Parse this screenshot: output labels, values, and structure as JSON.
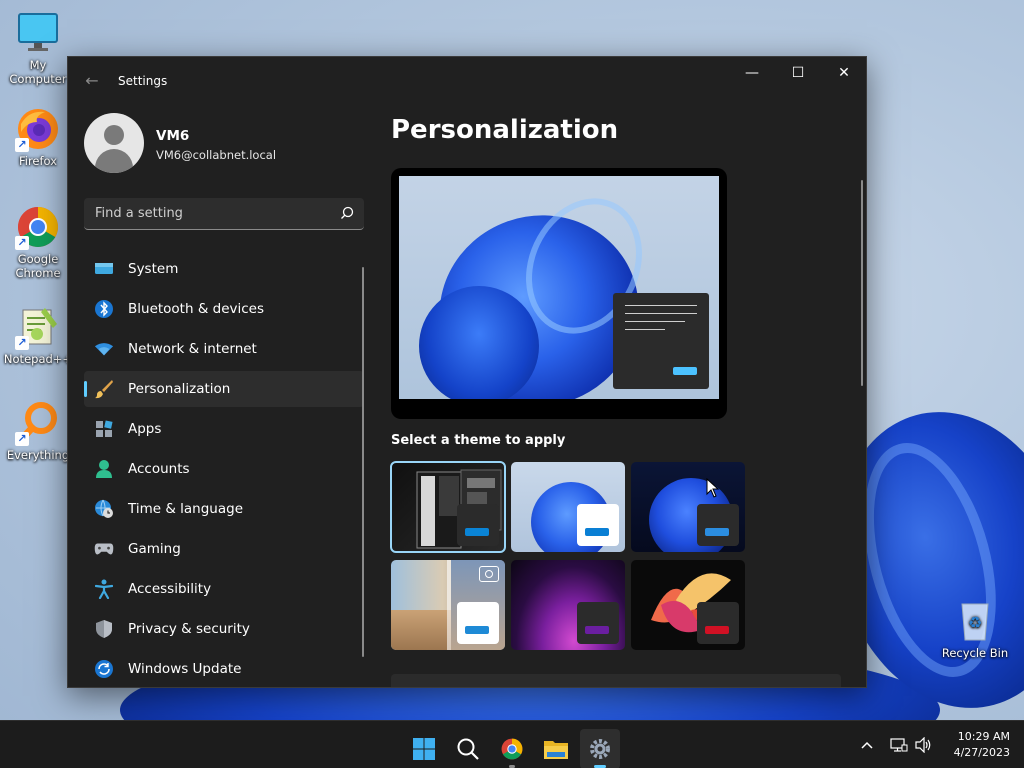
{
  "desktop": {
    "icons": [
      {
        "label": "My Computer",
        "icon": "monitor-icon"
      },
      {
        "label": "Firefox",
        "icon": "firefox-icon"
      },
      {
        "label": "Google Chrome",
        "icon": "chrome-icon"
      },
      {
        "label": "Notepad++",
        "icon": "notepadpp-icon"
      },
      {
        "label": "Everything",
        "icon": "everything-search-icon"
      },
      {
        "label": "Recycle Bin",
        "icon": "recycle-bin-icon"
      }
    ]
  },
  "window": {
    "title": "Settings",
    "back_icon": "back-arrow-icon",
    "controls": {
      "minimize": "—",
      "maximize": "☐",
      "close": "✕"
    }
  },
  "profile": {
    "name": "VM6",
    "email": "VM6@collabnet.local"
  },
  "search": {
    "placeholder": "Find a setting",
    "value": ""
  },
  "sidebar": {
    "items": [
      {
        "label": "System",
        "icon": "system-icon",
        "active": false
      },
      {
        "label": "Bluetooth & devices",
        "icon": "bluetooth-icon",
        "active": false
      },
      {
        "label": "Network & internet",
        "icon": "wifi-icon",
        "active": false
      },
      {
        "label": "Personalization",
        "icon": "paintbrush-icon",
        "active": true
      },
      {
        "label": "Apps",
        "icon": "apps-icon",
        "active": false
      },
      {
        "label": "Accounts",
        "icon": "accounts-icon",
        "active": false
      },
      {
        "label": "Time & language",
        "icon": "globe-clock-icon",
        "active": false
      },
      {
        "label": "Gaming",
        "icon": "gamepad-icon",
        "active": false
      },
      {
        "label": "Accessibility",
        "icon": "accessibility-icon",
        "active": false
      },
      {
        "label": "Privacy & security",
        "icon": "shield-icon",
        "active": false
      },
      {
        "label": "Windows Update",
        "icon": "update-icon",
        "active": false
      }
    ]
  },
  "main": {
    "title": "Personalization",
    "themes_label": "Select a theme to apply",
    "themes": [
      {
        "name": "current-theme",
        "selected": true,
        "chip_color": "#2b2b2b",
        "accent_color": "#0a84d6"
      },
      {
        "name": "windows-light",
        "selected": false,
        "chip_color": "#ffffff",
        "accent_color": "#0a7fd4"
      },
      {
        "name": "windows-dark",
        "selected": false,
        "chip_color": "#2b2b2b",
        "accent_color": "#2b8de0"
      },
      {
        "name": "windows-spotlight",
        "selected": false,
        "chip_color": "#ffffff",
        "accent_color": "#1e8ad6"
      },
      {
        "name": "glow",
        "selected": false,
        "chip_color": "#2b2b2b",
        "accent_color": "#6a1ea0"
      },
      {
        "name": "captured-motion",
        "selected": false,
        "chip_color": "#2b2b2b",
        "accent_color": "#d11124"
      }
    ]
  },
  "taskbar": {
    "apps": [
      "start-icon",
      "search-icon",
      "chrome-icon",
      "file-explorer-icon",
      "settings-icon"
    ],
    "active_app": "settings-icon",
    "time": "10:29 AM",
    "date": "4/27/2023"
  },
  "colors": {
    "accent": "#60cdff",
    "window_bg": "#202020",
    "taskbar_bg": "#1c1c1c"
  }
}
